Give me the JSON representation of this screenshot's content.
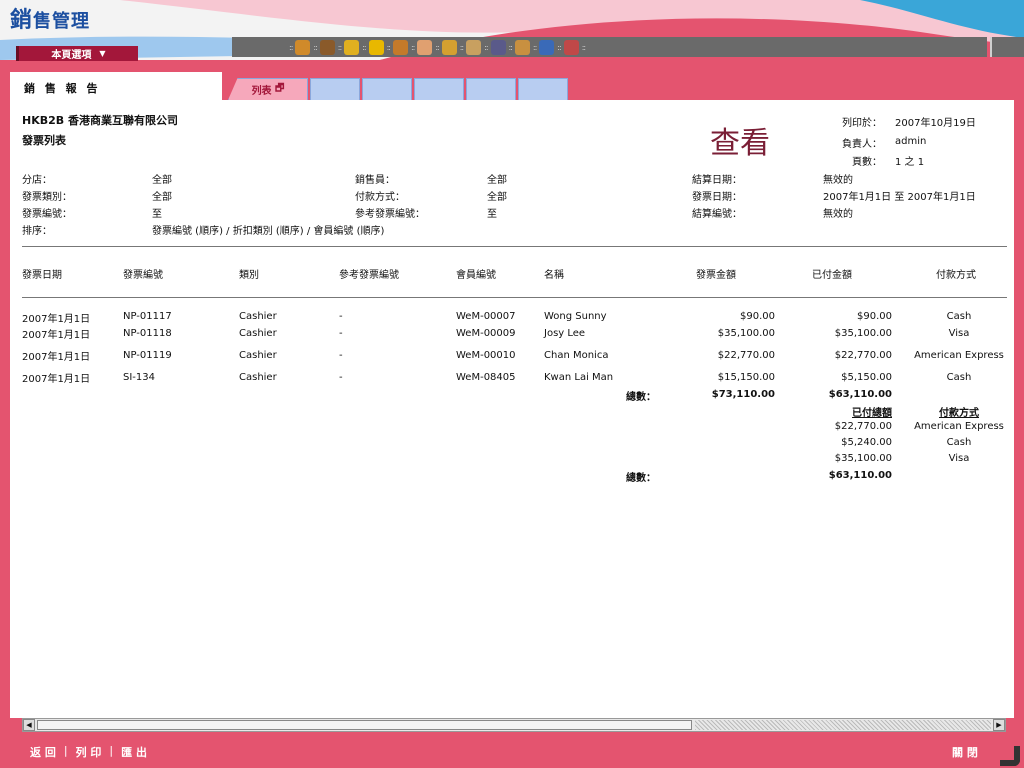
{
  "app": {
    "title_big": "銷",
    "title_rest": "售管理"
  },
  "page_menu": {
    "label": "本頁選項"
  },
  "toolbar": {
    "icons": [
      {
        "name": "box-icon",
        "color": "#d08a2a"
      },
      {
        "name": "users-icon",
        "color": "#8a5a2a"
      },
      {
        "name": "clock-icon",
        "color": "#e0b020"
      },
      {
        "name": "coin-icon",
        "color": "#e8b800"
      },
      {
        "name": "home-icon",
        "color": "#c47a2a"
      },
      {
        "name": "ear-icon",
        "color": "#e0a070"
      },
      {
        "name": "calculator-icon",
        "color": "#d4a030"
      },
      {
        "name": "clipboard-icon",
        "color": "#c8a060"
      },
      {
        "name": "group-icon",
        "color": "#5a5a8a"
      },
      {
        "name": "notepad-icon",
        "color": "#c89040"
      },
      {
        "name": "monitor-icon",
        "color": "#3a6ab8"
      },
      {
        "name": "people-icon",
        "color": "#c04848"
      }
    ]
  },
  "section": {
    "title": "銷 售 報 告"
  },
  "tabs": {
    "active_label": "列表"
  },
  "report": {
    "company": "HKB2B 香港商業互聯有限公司",
    "title": "發票列表",
    "view_label": "查看",
    "printed_label": "列印於：",
    "printed_value": "2007年10月19日",
    "owner_label": "負責人：",
    "owner_value": "admin",
    "page_label": "頁數：",
    "page_value": "1 之 1"
  },
  "filters": {
    "branch_label": "分店：",
    "branch_value": "全部",
    "salesperson_label": "銷售員：",
    "salesperson_value": "全部",
    "settle_date_label": "結算日期：",
    "settle_date_value": "無效的",
    "invoice_type_label": "發票類別：",
    "invoice_type_value": "全部",
    "payment_label": "付款方式：",
    "payment_value": "全部",
    "invoice_date_label": "發票日期：",
    "invoice_date_value": "2007年1月1日 至 2007年1月1日",
    "invoice_no_label": "發票編號：",
    "invoice_no_value": "至",
    "ref_no_label": "參考發票編號：",
    "ref_no_value": "至",
    "settle_no_label": "結算編號：",
    "settle_no_value": "無效的",
    "sort_label": "排序：",
    "sort_value": "發票編號 (順序) / 折扣類別 (順序) / 會員編號 (順序)"
  },
  "table": {
    "headers": {
      "date": "發票日期",
      "invoice_no": "發票編號",
      "type": "類別",
      "ref_no": "參考發票編號",
      "member_no": "會員編號",
      "name": "名稱",
      "amount": "發票金額",
      "paid": "已付金額",
      "payment": "付款方式"
    },
    "rows": [
      {
        "date": "2007年1月1日",
        "invoice_no": "NP-01117",
        "type": "Cashier",
        "ref_no": "-",
        "member_no": "WeM-00007",
        "name": "Wong Sunny",
        "amount": "$90.00",
        "paid": "$90.00",
        "payment": "Cash"
      },
      {
        "date": "2007年1月1日",
        "invoice_no": "NP-01118",
        "type": "Cashier",
        "ref_no": "-",
        "member_no": "WeM-00009",
        "name": "Josy Lee",
        "amount": "$35,100.00",
        "paid": "$35,100.00",
        "payment": "Visa"
      },
      {
        "date": "2007年1月1日",
        "invoice_no": "NP-01119",
        "type": "Cashier",
        "ref_no": "-",
        "member_no": "WeM-00010",
        "name": "Chan Monica",
        "amount": "$22,770.00",
        "paid": "$22,770.00",
        "payment": "American Express"
      },
      {
        "date": "2007年1月1日",
        "invoice_no": "SI-134",
        "type": "Cashier",
        "ref_no": "-",
        "member_no": "WeM-08405",
        "name": "Kwan Lai Man",
        "amount": "$15,150.00",
        "paid": "$5,150.00",
        "payment": "Cash"
      }
    ],
    "total_label": "總數：",
    "total_amount": "$73,110.00",
    "total_paid": "$63,110.00",
    "summary": {
      "paid_header": "已付總額",
      "payment_header": "付款方式",
      "rows": [
        {
          "paid": "$22,770.00",
          "payment": "American Express"
        },
        {
          "paid": "$5,240.00",
          "payment": "Cash"
        },
        {
          "paid": "$35,100.00",
          "payment": "Visa"
        }
      ],
      "total_label": "總數：",
      "total_paid": "$63,110.00"
    }
  },
  "footer": {
    "back": "返 回",
    "print": "列 印",
    "export": "匯 出",
    "close": "關 閉"
  }
}
